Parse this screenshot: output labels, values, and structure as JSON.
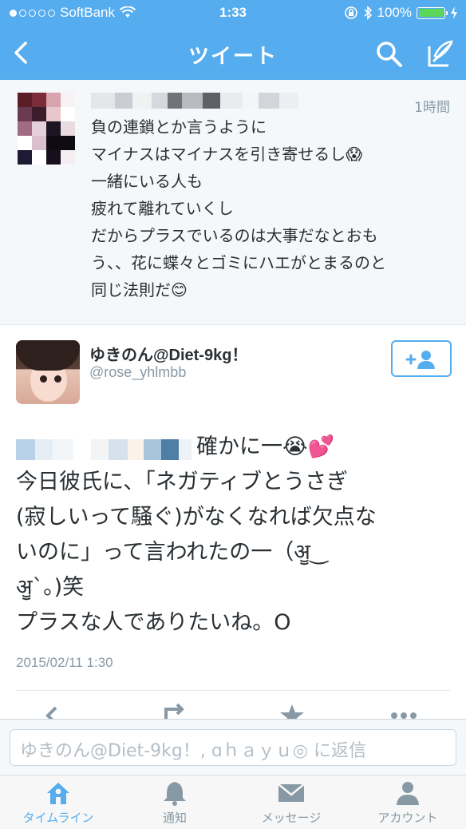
{
  "status_bar": {
    "carrier": "SoftBank",
    "time": "1:33",
    "battery": "100%",
    "battery_level": 1.0
  },
  "header": {
    "title": "ツイート",
    "back_icon": "back-arrow-icon",
    "search_icon": "search-icon",
    "compose_icon": "compose-icon"
  },
  "reply_tweet": {
    "time": "1時間",
    "text": "負の連鎖とか言うように\nマイナスはマイナスを引き寄せるし😱\n一緒にいる人も\n疲れて離れていくし\nだからプラスでいるのは大事だなとおも\nう、、花に蝶々とゴミにハエがとまるのと\n同じ法則だ😊"
  },
  "tweet": {
    "display_name": "ゆきのん@Diet-9kg！",
    "handle": "@rose_yhlmbb",
    "text_line1": "確かに一😭💕",
    "text_rest": "今日彼氏に、「ネガティブとうさぎ\n(寂しいって騒ぐ)がなくなれば欠点な\nいのに」って言われたの一（ॷ‿\nॷ`。)笑\nプラスな人でありたいね。O",
    "timestamp": "2015/02/11 1:30",
    "follow_icon": "add-user-icon"
  },
  "reply_bar": {
    "placeholder": "ゆきのん@Diet-9kg！, ɑｈａｙｕ◎ に返信"
  },
  "tabs": [
    {
      "label": "タイムライン",
      "icon": "home-icon",
      "active": true
    },
    {
      "label": "通知",
      "icon": "bell-icon",
      "active": false
    },
    {
      "label": "メッセージ",
      "icon": "envelope-icon",
      "active": false
    },
    {
      "label": "アカウント",
      "icon": "person-icon",
      "active": false
    }
  ],
  "colors": {
    "brand": "#55acee",
    "background_alt": "#f5f8fa",
    "muted_text": "#8899a6"
  }
}
